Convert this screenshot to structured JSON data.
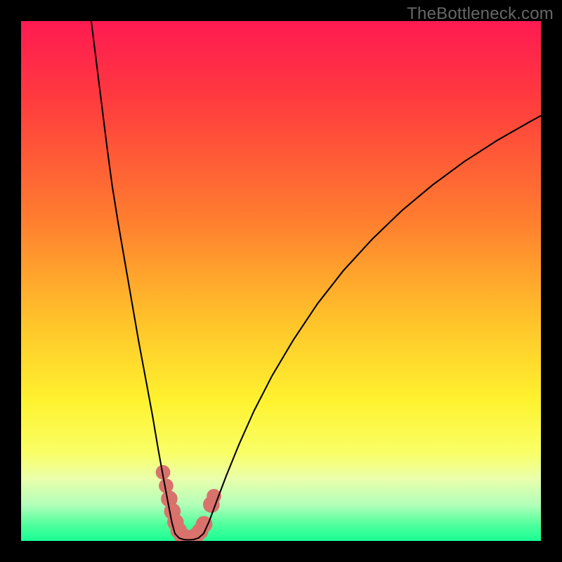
{
  "watermark": "TheBottleneck.com",
  "chart_data": {
    "type": "line",
    "title": "",
    "xlabel": "",
    "ylabel": "",
    "xlim": [
      0,
      100
    ],
    "ylim": [
      0,
      100
    ],
    "gradient_stops": [
      {
        "pct": 0,
        "color": "#ff1a52"
      },
      {
        "pct": 15,
        "color": "#ff3b3e"
      },
      {
        "pct": 38,
        "color": "#ff7d2f"
      },
      {
        "pct": 58,
        "color": "#ffc42a"
      },
      {
        "pct": 73,
        "color": "#fff22f"
      },
      {
        "pct": 83,
        "color": "#f9ff66"
      },
      {
        "pct": 88,
        "color": "#eaffab"
      },
      {
        "pct": 93,
        "color": "#b3ffb9"
      },
      {
        "pct": 97,
        "color": "#4dff9c"
      },
      {
        "pct": 100,
        "color": "#19ff95"
      }
    ],
    "series": [
      {
        "name": "left-branch",
        "x": [
          13.5,
          14.5,
          15.5,
          16.5,
          17.5,
          18.7,
          20.0,
          21.3,
          22.6,
          24.0,
          25.3,
          26.4,
          27.4,
          28.3,
          29.0,
          29.6
        ],
        "y": [
          100.0,
          92.0,
          84.0,
          76.0,
          68.5,
          61.0,
          53.5,
          46.0,
          38.5,
          31.0,
          24.0,
          17.5,
          12.0,
          7.2,
          3.6,
          1.4
        ]
      },
      {
        "name": "valley",
        "x": [
          29.6,
          30.4,
          31.3,
          32.2,
          33.1,
          34.1,
          35.1
        ],
        "y": [
          1.4,
          0.55,
          0.25,
          0.2,
          0.25,
          0.55,
          1.4
        ]
      },
      {
        "name": "right-branch",
        "x": [
          35.1,
          36.2,
          37.6,
          39.5,
          41.9,
          44.8,
          48.3,
          52.4,
          57.0,
          62.0,
          67.5,
          73.2,
          79.2,
          85.3,
          91.5,
          97.8,
          100.0
        ],
        "y": [
          1.4,
          3.8,
          7.6,
          12.6,
          18.5,
          25.0,
          31.8,
          38.7,
          45.6,
          52.0,
          58.0,
          63.5,
          68.5,
          73.0,
          77.0,
          80.6,
          81.8
        ]
      }
    ],
    "markers": {
      "name": "highlight-points",
      "color": "#d9726c",
      "points": [
        {
          "x": 27.3,
          "y": 13.2,
          "r": 1.4
        },
        {
          "x": 27.9,
          "y": 10.6,
          "r": 1.4
        },
        {
          "x": 28.5,
          "y": 8.1,
          "r": 1.6
        },
        {
          "x": 29.1,
          "y": 5.7,
          "r": 1.6
        },
        {
          "x": 29.7,
          "y": 3.6,
          "r": 1.6
        },
        {
          "x": 30.3,
          "y": 2.0,
          "r": 1.6
        },
        {
          "x": 31.0,
          "y": 1.0,
          "r": 1.6
        },
        {
          "x": 31.8,
          "y": 0.55,
          "r": 1.6
        },
        {
          "x": 32.7,
          "y": 0.55,
          "r": 1.6
        },
        {
          "x": 33.6,
          "y": 0.95,
          "r": 1.6
        },
        {
          "x": 34.4,
          "y": 1.8,
          "r": 1.6
        },
        {
          "x": 35.2,
          "y": 3.2,
          "r": 1.6
        },
        {
          "x": 36.6,
          "y": 7.0,
          "r": 1.6
        },
        {
          "x": 37.1,
          "y": 8.6,
          "r": 1.4
        }
      ]
    }
  }
}
